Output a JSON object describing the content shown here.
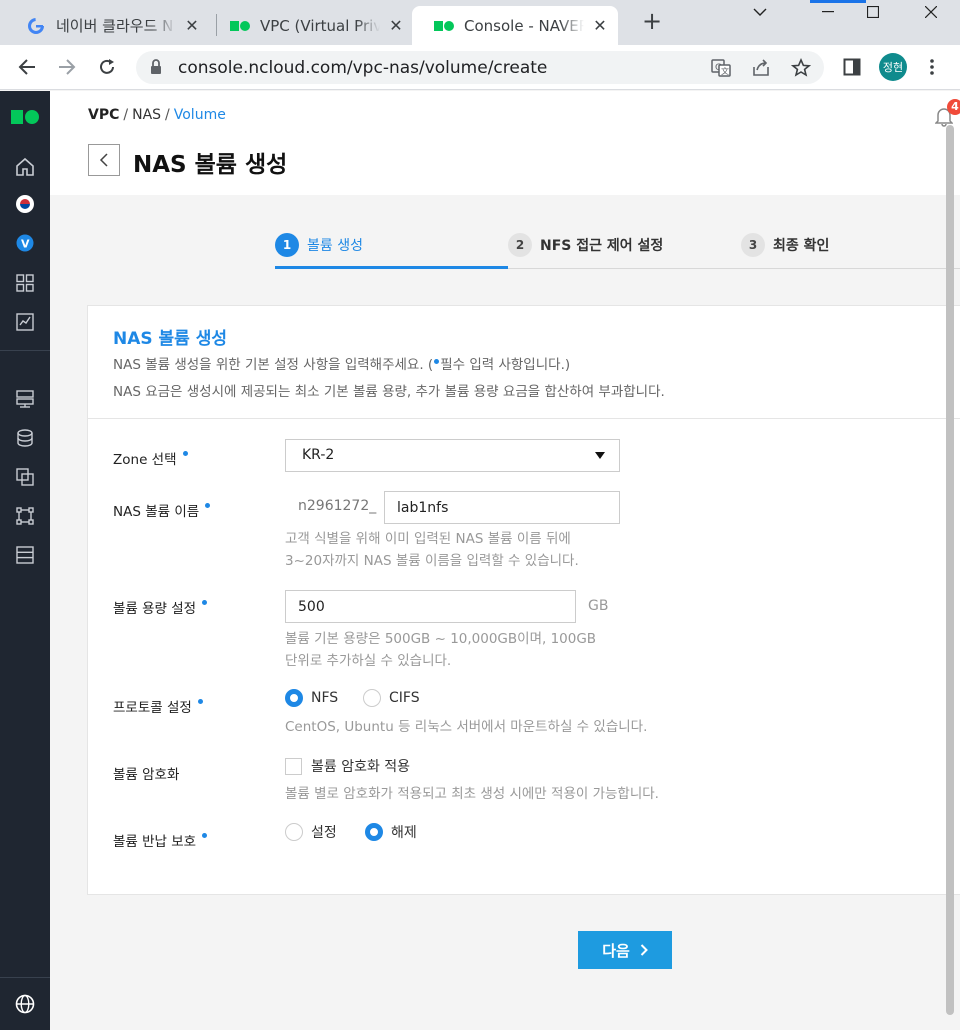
{
  "browser": {
    "tabs": [
      {
        "title": "네이버 클라우드 N",
        "favicon": "google-g-icon",
        "active": false
      },
      {
        "title": "VPC (Virtual Privat",
        "favicon": "ncloud-logo-icon",
        "active": false
      },
      {
        "title": "Console - NAVER",
        "favicon": "ncloud-logo-icon",
        "active": true
      }
    ],
    "url": "console.ncloud.com/vpc-nas/volume/create",
    "profile_initials": "정현"
  },
  "breadcrumb": {
    "vpc": "VPC",
    "sep": "/",
    "nas": "NAS",
    "volume": "Volume"
  },
  "page": {
    "title": "NAS 볼륨 생성",
    "notification_count": "4"
  },
  "steps": [
    {
      "num": "1",
      "label": "볼륨 생성"
    },
    {
      "num": "2",
      "label": "NFS 접근 제어 설정"
    },
    {
      "num": "3",
      "label": "최종 확인"
    }
  ],
  "form": {
    "title": "NAS 볼륨 생성",
    "desc1_a": "NAS 볼륨 생성을 위한 기본 설정 사항을 입력해주세요. (",
    "desc1_b": "필수 입력 사항입니다.)",
    "desc2": "NAS 요금은 생성시에 제공되는 최소 기본 볼륨 용량, 추가 볼륨 용량 요금을 합산하여 부과합니다.",
    "zone_label": "Zone 선택",
    "zone_value": "KR-2",
    "name_label": "NAS 볼륨 이름",
    "name_prefix": "n2961272_",
    "name_value": "lab1nfs",
    "name_help1": "고객 식별을 위해 이미 입력된 NAS 볼륨 이름 뒤에",
    "name_help2": "3~20자까지 NAS 볼륨 이름을 입력할 수 있습니다.",
    "size_label": "볼륨 용량 설정",
    "size_value": "500",
    "size_unit": "GB",
    "size_help1": "볼륨 기본 용량은 500GB ~ 10,000GB이며, 100GB",
    "size_help2": "단위로 추가하실 수 있습니다.",
    "protocol_label": "프로토콜 설정",
    "protocol_nfs": "NFS",
    "protocol_cifs": "CIFS",
    "protocol_help": "CentOS, Ubuntu 등 리눅스 서버에서 마운트하실 수 있습니다.",
    "encrypt_label": "볼륨 암호화",
    "encrypt_option": "볼륨 암호화 적용",
    "encrypt_help": "볼륨 별로 암호화가 적용되고 최초 생성 시에만 적용이 가능합니다.",
    "return_label": "볼륨 반납 보호",
    "return_set": "설정",
    "return_unset": "해제"
  },
  "next_button": "다음",
  "colors": {
    "accent": "#1e88e5",
    "nav_bg": "#1f2631",
    "button": "#1e9be0",
    "brand_green": "#03c75a"
  }
}
